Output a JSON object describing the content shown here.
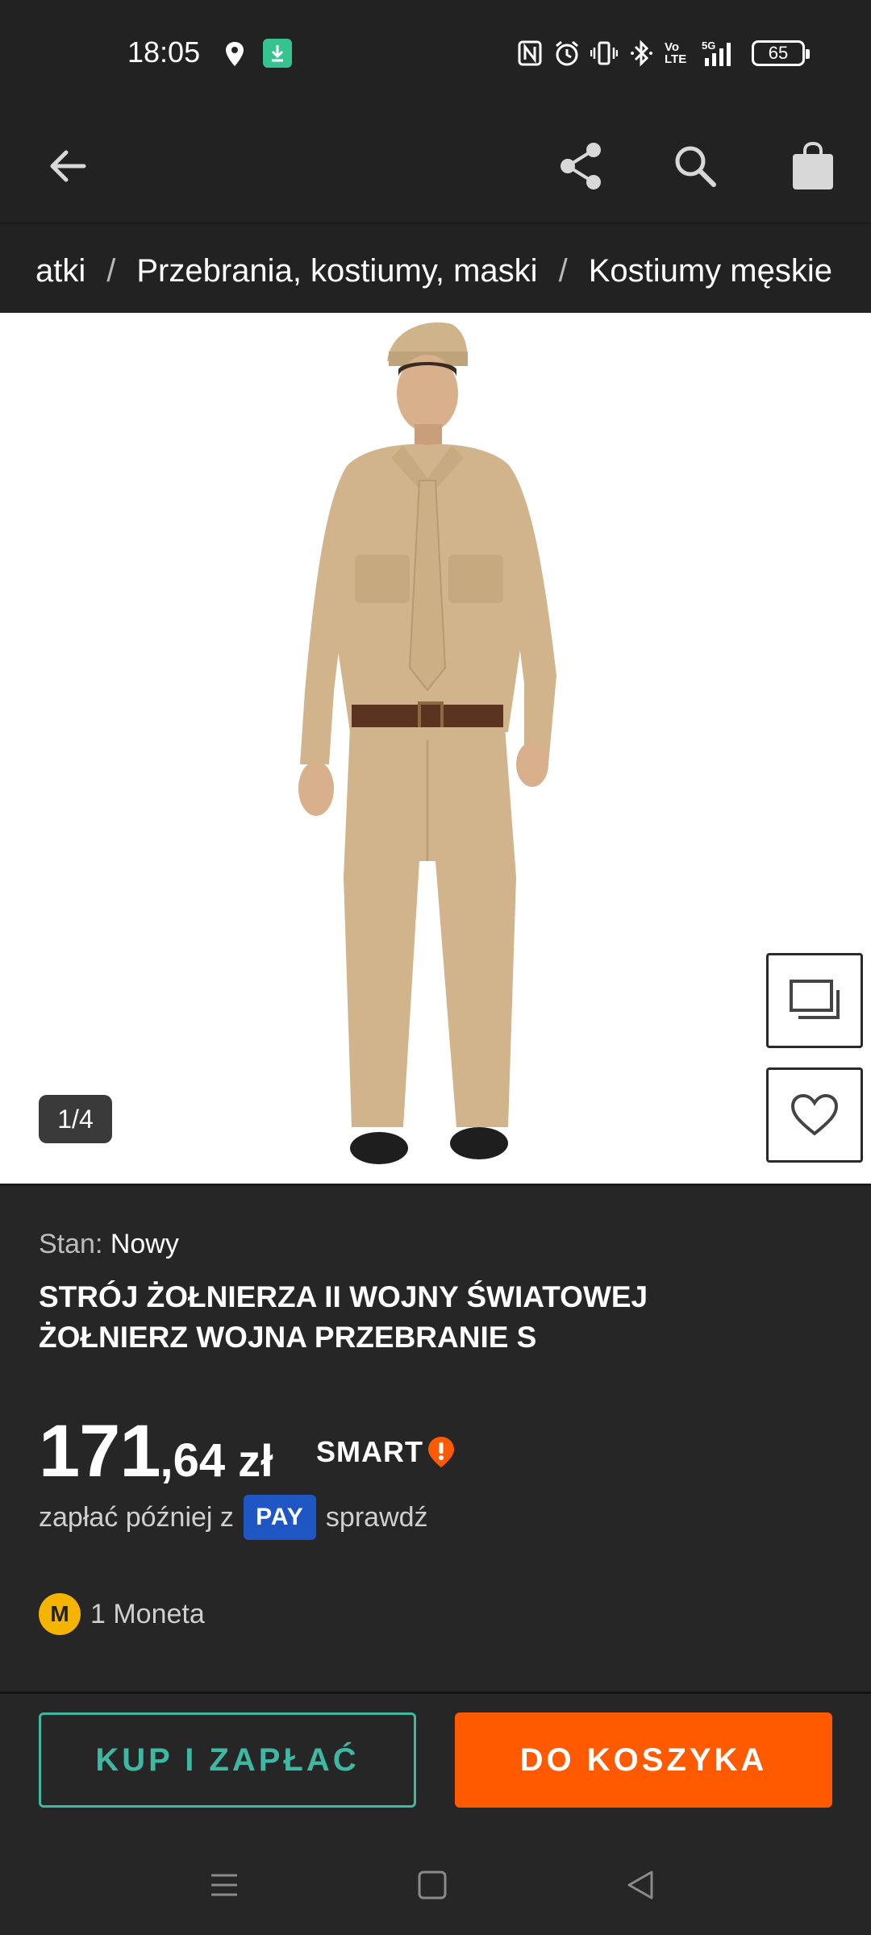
{
  "status_bar": {
    "time": "18:05",
    "network": "5G",
    "volte": "Vo LTE",
    "battery": "65",
    "icons": [
      "location-icon",
      "download-icon",
      "nfc-icon",
      "alarm-icon",
      "vibrate-icon",
      "bluetooth-icon",
      "volte-icon",
      "signal-icon",
      "battery-icon"
    ]
  },
  "app_bar": {
    "icons": [
      "back-arrow-icon",
      "share-icon",
      "search-icon",
      "shopping-bag-icon"
    ]
  },
  "breadcrumb": {
    "items": [
      "atki",
      "Przebrania, kostiumy, maski",
      "Kostiumy męskie"
    ],
    "separator": "/"
  },
  "gallery": {
    "counter": "1/4",
    "side_buttons": [
      "gallery-icon",
      "heart-icon"
    ]
  },
  "product": {
    "condition_label": "Stan:",
    "condition_value": "Nowy",
    "title": "STRÓJ ŻOŁNIERZA II WOJNY ŚWIATOWEJ ŻOŁNIERZ WOJNA PRZEBRANIE S",
    "price_int": "171",
    "price_dec": ",64",
    "currency": "zł",
    "smart_label": "SMART",
    "pay_later_prefix": "zapłać później z",
    "pay_badge": "PAY",
    "pay_later_suffix": "sprawdź",
    "coins": "1 Moneta",
    "coin_letter": "M"
  },
  "actions": {
    "buy_now": "KUP I ZAPŁAĆ",
    "add_to_cart": "DO KOSZYKA"
  },
  "colors": {
    "background": "#222222",
    "accent_orange": "#ff5a00",
    "accent_teal": "#3fb8a3",
    "pay_blue": "#1e56c4",
    "coin_yellow": "#f4b400"
  }
}
